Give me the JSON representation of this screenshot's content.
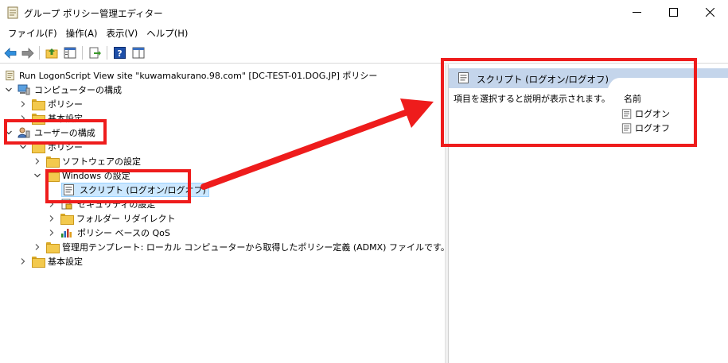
{
  "window": {
    "title": "グループ ポリシー管理エディター",
    "minimize_icon": "minimize-icon",
    "maximize_icon": "maximize-icon",
    "close_icon": "close-icon"
  },
  "menu": [
    "ファイル(F)",
    "操作(A)",
    "表示(V)",
    "ヘルプ(H)"
  ],
  "toolbar": {
    "buttons": [
      "back-arrow-icon",
      "forward-arrow-icon",
      "up-folder-icon",
      "show-hide-tree-icon",
      "export-list-icon",
      "help-icon",
      "properties-view-icon"
    ]
  },
  "tree": {
    "root": "Run LogonScript View site \"kuwamakurano.98.com\" [DC-TEST-01.DOG.JP] ポリシー",
    "computer_config": "コンピューターの構成",
    "computer_policy": "ポリシー",
    "computer_basic": "基本設定",
    "user_config": "ユーザーの構成",
    "user_policy": "ポリシー",
    "software_settings": "ソフトウェアの設定",
    "windows_settings": "Windows の設定",
    "scripts": "スクリプト (ログオン/ログオフ)",
    "security_settings": "セキュリティの設定",
    "folder_redirect": "フォルダー リダイレクト",
    "policy_qos": "ポリシー ベースの QoS",
    "admin_templates": "管理用テンプレート: ローカル コンピューターから取得したポリシー定義 (ADMX) ファイルです。",
    "user_basic": "基本設定"
  },
  "details": {
    "header_title": "スクリプト (ログオン/ログオフ)",
    "description": "項目を選択すると説明が表示されます。",
    "column_name": "名前",
    "items": [
      "ログオン",
      "ログオフ"
    ]
  },
  "colors": {
    "annotation_red": "#ee1c1c",
    "header_blue": "#c4d5eb",
    "selection": "#cce8ff"
  }
}
